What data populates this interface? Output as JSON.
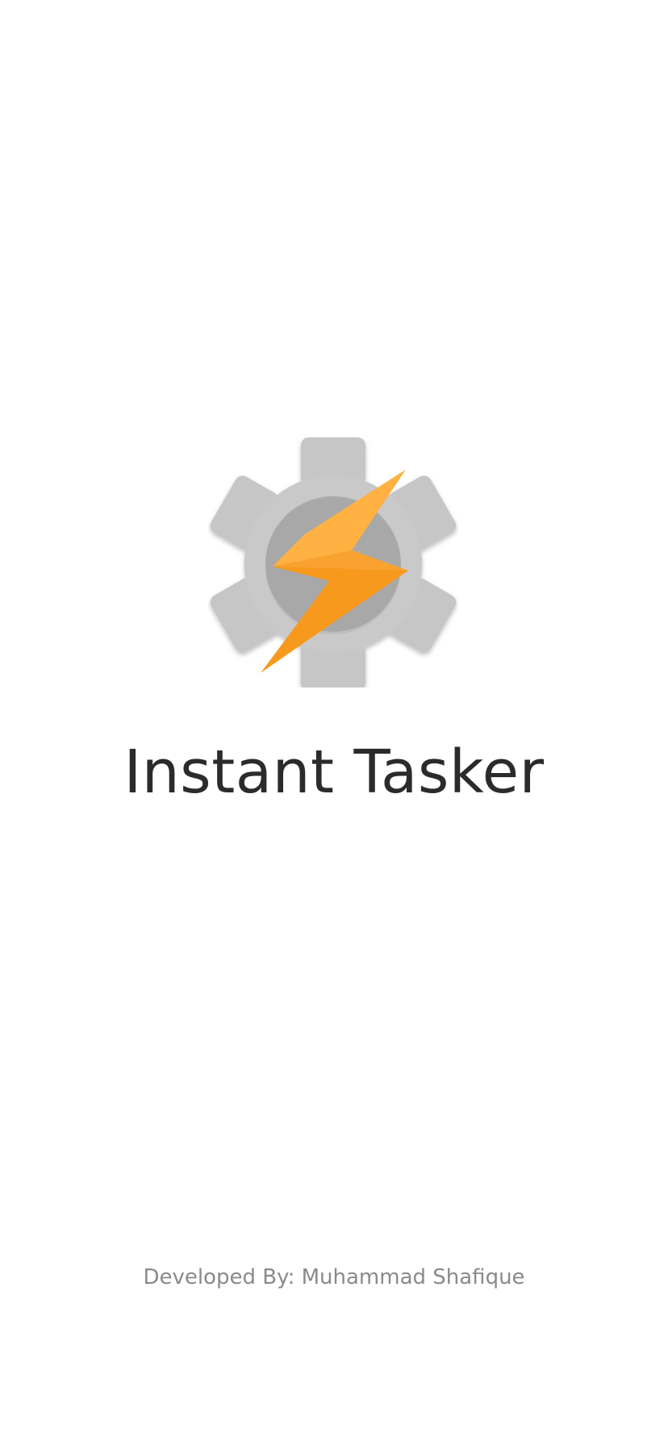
{
  "splash": {
    "logo_icon": "tasker-gear-lightning-icon",
    "app_title": "Instant Tasker",
    "developer_credit": "Developed By: Muhammad Shafique"
  },
  "colors": {
    "background": "#ffffff",
    "gear": "#c4c4c4",
    "gear_center": "#aaaaaa",
    "bolt_light": "#ffb545",
    "bolt_dark": "#f7991c",
    "title_text": "#2b2b2b",
    "credit_text": "#8a8a8a"
  }
}
